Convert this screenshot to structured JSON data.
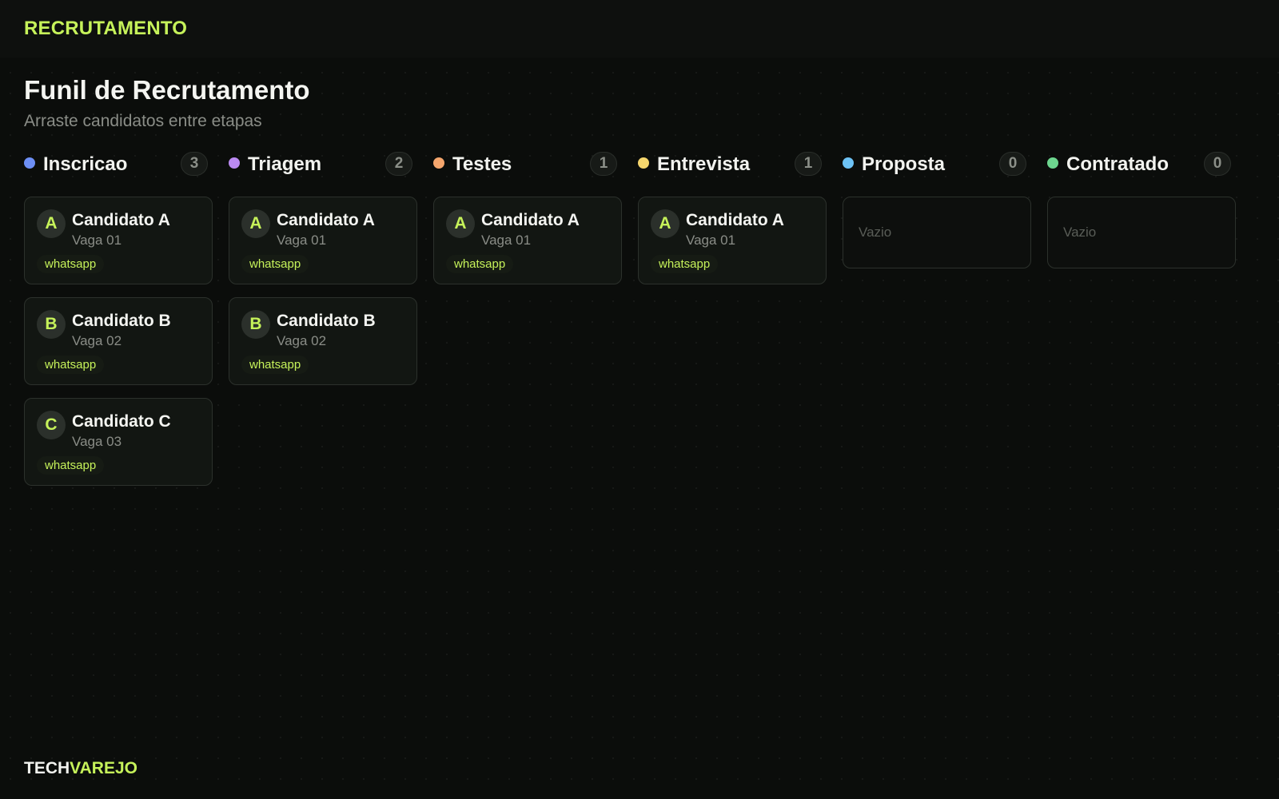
{
  "app": {
    "brand": "RECRUTAMENTO"
  },
  "page": {
    "title": "Funil de Recrutamento",
    "subtitle": "Arraste candidatos entre etapas"
  },
  "colors": {
    "accent": "#c6f25a",
    "background": "#0b0d0b"
  },
  "columns": [
    {
      "id": "inscricao",
      "title": "Inscricao",
      "count": "3",
      "dot_color": "#6d8ff5",
      "empty_text": "",
      "cards": [
        {
          "initial": "A",
          "name": "Candidato A",
          "job": "Vaga 01",
          "tag": "whatsapp"
        },
        {
          "initial": "B",
          "name": "Candidato B",
          "job": "Vaga 02",
          "tag": "whatsapp"
        },
        {
          "initial": "C",
          "name": "Candidato C",
          "job": "Vaga 03",
          "tag": "whatsapp"
        }
      ]
    },
    {
      "id": "triagem",
      "title": "Triagem",
      "count": "2",
      "dot_color": "#bb8af2",
      "empty_text": "",
      "cards": [
        {
          "initial": "A",
          "name": "Candidato A",
          "job": "Vaga 01",
          "tag": "whatsapp"
        },
        {
          "initial": "B",
          "name": "Candidato B",
          "job": "Vaga 02",
          "tag": "whatsapp"
        }
      ]
    },
    {
      "id": "testes",
      "title": "Testes",
      "count": "1",
      "dot_color": "#f5a66d",
      "empty_text": "",
      "cards": [
        {
          "initial": "A",
          "name": "Candidato A",
          "job": "Vaga 01",
          "tag": "whatsapp"
        }
      ]
    },
    {
      "id": "entrevista",
      "title": "Entrevista",
      "count": "1",
      "dot_color": "#f5d66d",
      "empty_text": "",
      "cards": [
        {
          "initial": "A",
          "name": "Candidato A",
          "job": "Vaga 01",
          "tag": "whatsapp"
        }
      ]
    },
    {
      "id": "proposta",
      "title": "Proposta",
      "count": "0",
      "dot_color": "#6dc2f5",
      "empty_text": "Vazio",
      "cards": []
    },
    {
      "id": "contratado",
      "title": "Contratado",
      "count": "0",
      "dot_color": "#6dd68f",
      "empty_text": "Vazio",
      "cards": []
    }
  ],
  "footer": {
    "brand_part1": "TECH",
    "brand_part2": "VAREJO"
  }
}
